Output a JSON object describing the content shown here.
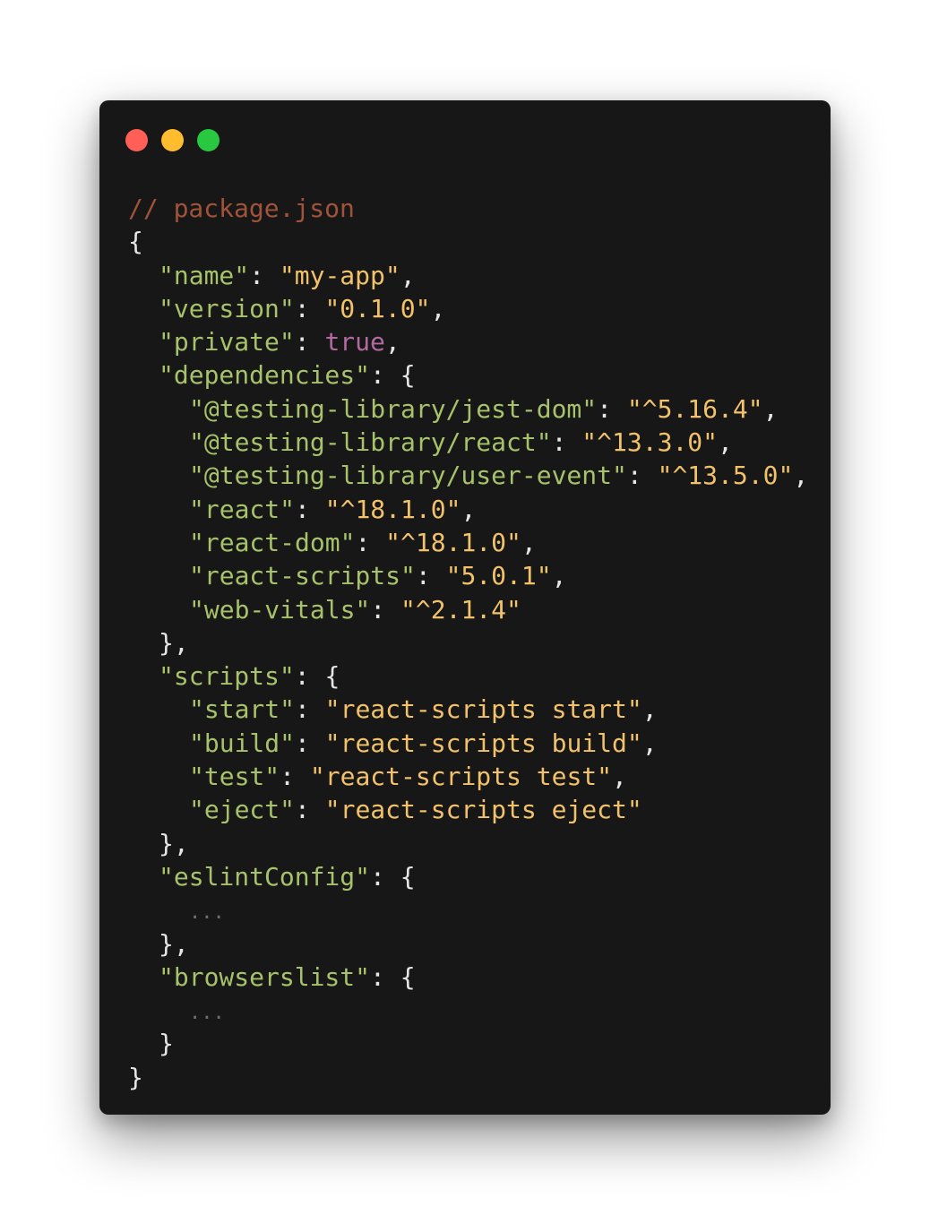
{
  "window": {
    "traffic_lights": [
      {
        "name": "close",
        "color": "#ff5f57"
      },
      {
        "name": "minimize",
        "color": "#febc2e"
      },
      {
        "name": "maximize",
        "color": "#28c840"
      }
    ]
  },
  "colors": {
    "background": "#171717",
    "comment": "#a0533a",
    "key": "#a7c26a",
    "string": "#f2c26b",
    "boolean": "#b36aa0",
    "punctuation": "#e6e6e6"
  },
  "code": {
    "comment": "// package.json",
    "name_key": "\"name\"",
    "name_val": "\"my-app\"",
    "version_key": "\"version\"",
    "version_val": "\"0.1.0\"",
    "private_key": "\"private\"",
    "private_val": "true",
    "dependencies_key": "\"dependencies\"",
    "dependencies": [
      {
        "key": "\"@testing-library/jest-dom\"",
        "value": "\"^5.16.4\"",
        "comma": ","
      },
      {
        "key": "\"@testing-library/react\"",
        "value": "\"^13.3.0\"",
        "comma": ","
      },
      {
        "key": "\"@testing-library/user-event\"",
        "value": "\"^13.5.0\"",
        "comma": ","
      },
      {
        "key": "\"react\"",
        "value": "\"^18.1.0\"",
        "comma": ","
      },
      {
        "key": "\"react-dom\"",
        "value": "\"^18.1.0\"",
        "comma": ","
      },
      {
        "key": "\"react-scripts\"",
        "value": "\"5.0.1\"",
        "comma": ","
      },
      {
        "key": "\"web-vitals\"",
        "value": "\"^2.1.4\"",
        "comma": ""
      }
    ],
    "scripts_key": "\"scripts\"",
    "scripts": [
      {
        "key": "\"start\"",
        "value": "\"react-scripts start\"",
        "comma": ","
      },
      {
        "key": "\"build\"",
        "value": "\"react-scripts build\"",
        "comma": ","
      },
      {
        "key": "\"test\"",
        "value": "\"react-scripts test\"",
        "comma": ","
      },
      {
        "key": "\"eject\"",
        "value": "\"react-scripts eject\"",
        "comma": ""
      }
    ],
    "eslint_key": "\"eslintConfig\"",
    "browserslist_key": "\"browserslist\"",
    "ellipsis": "...",
    "open_brace": "{",
    "close_brace": "}",
    "close_brace_comma": "},",
    "colon": ": ",
    "comma": ","
  }
}
